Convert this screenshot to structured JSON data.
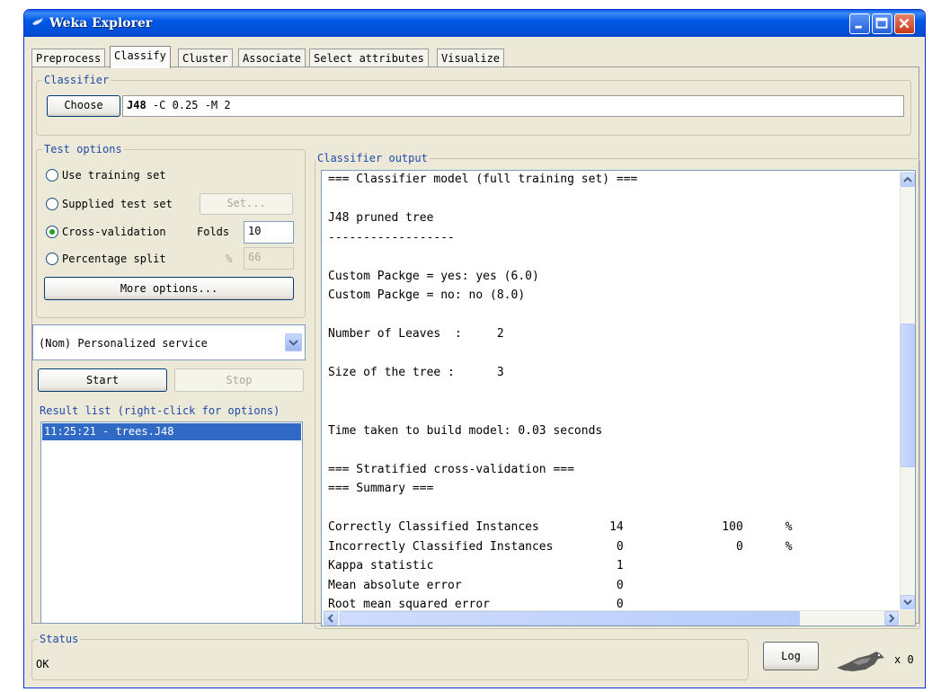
{
  "window": {
    "title": "Weka Explorer",
    "icon": "weka-bird-icon",
    "controls": [
      "minimize",
      "maximize",
      "close"
    ]
  },
  "tabs": [
    {
      "label": "Preprocess",
      "active": false
    },
    {
      "label": "Classify",
      "active": true
    },
    {
      "label": "Cluster",
      "active": false
    },
    {
      "label": "Associate",
      "active": false
    },
    {
      "label": "Select attributes",
      "active": false
    },
    {
      "label": "Visualize",
      "active": false
    }
  ],
  "classifier": {
    "legend": "Classifier",
    "choose_label": "Choose",
    "name": "J48",
    "options": " -C 0.25 -M 2"
  },
  "test_options": {
    "legend": "Test options",
    "use_training_set": "Use training set",
    "supplied_test_set": "Supplied test set",
    "set_label": "Set...",
    "cross_validation": "Cross-validation",
    "folds_label": "Folds",
    "folds_value": "10",
    "percentage_split": "Percentage split",
    "percent_symbol": "%",
    "percent_value": "66",
    "selected": "cross_validation",
    "more_options_label": "More options..."
  },
  "class_attribute": {
    "selected": "(Nom) Personalized service"
  },
  "actions": {
    "start_label": "Start",
    "stop_label": "Stop"
  },
  "result_list": {
    "legend": "Result list (right-click for options)",
    "items": [
      "11:25:21 - trees.J48"
    ]
  },
  "classifier_output": {
    "legend": "Classifier output",
    "lines": [
      "=== Classifier model (full training set) ===",
      "",
      "J48 pruned tree",
      "------------------",
      "",
      "Custom Packge = yes: yes (6.0)",
      "Custom Packge = no: no (8.0)",
      "",
      "Number of Leaves  :\t2",
      "",
      "Size of the tree :\t3",
      "",
      "",
      "Time taken to build model: 0.03 seconds",
      "",
      "=== Stratified cross-validation ===",
      "=== Summary ===",
      "",
      "Correctly Classified Instances          14              100      %",
      "Incorrectly Classified Instances         0                0      %",
      "Kappa statistic                          1",
      "Mean absolute error                      0",
      "Root mean squared error                  0"
    ]
  },
  "status": {
    "legend": "Status",
    "text": "OK",
    "log_label": "Log",
    "x_count": "x 0"
  },
  "colors": {
    "titlebar": "#0058e6",
    "window_bg": "#ece9d8",
    "legend_text": "#1f4aa8",
    "selection": "#316ac5"
  }
}
